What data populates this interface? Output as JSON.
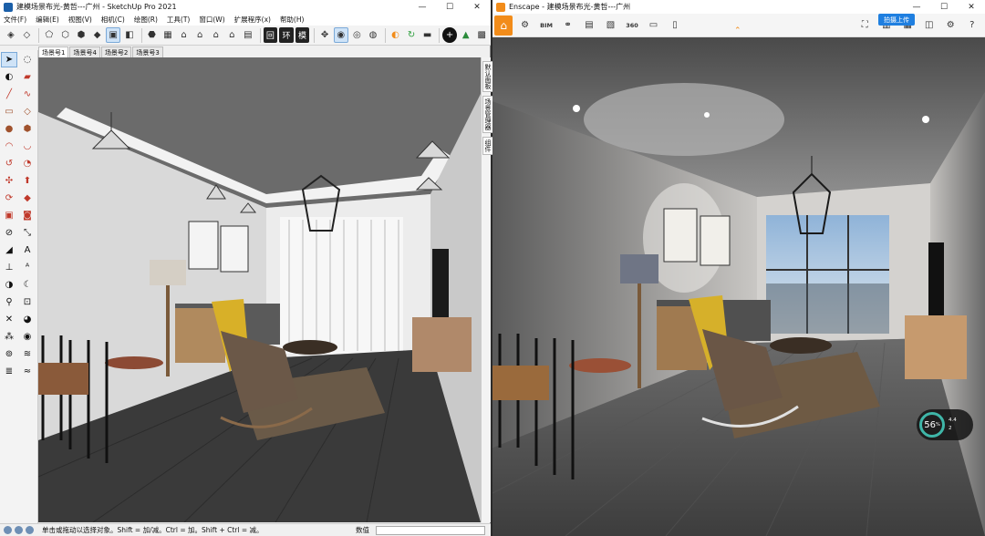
{
  "sketchup": {
    "window_title": "建模场景布光-黄哲---广州 - SketchUp Pro 2021",
    "menu": [
      "文件(F)",
      "编辑(E)",
      "视图(V)",
      "相机(C)",
      "绘图(R)",
      "工具(T)",
      "窗口(W)",
      "扩展程序(x)",
      "帮助(H)"
    ],
    "toolbar_text_icons": [
      "回",
      "环",
      "模"
    ],
    "scene_tabs": [
      "场景号1",
      "场景号4",
      "场景号2",
      "场景号3"
    ],
    "active_tab": "场景号1",
    "right_panel_tabs": [
      "默认面板",
      "场景管理器",
      "组件"
    ],
    "status_message": "单击或拖动以选择对象。Shift = 加/减。Ctrl = 加。Shift + Ctrl = 减。",
    "status_value_label": "数值"
  },
  "enscape": {
    "window_title": "Enscape - 建模场景布光-黄哲---广州",
    "upload_button": "拍摄上传",
    "toolbar_text_icons": [
      "BIM",
      "360"
    ],
    "gauge": {
      "percent": "56",
      "unit": "%",
      "stat_top": "4.4",
      "stat_bottom": "2"
    }
  },
  "colors": {
    "enscape_accent": "#f28c1a",
    "sketchup_blue": "#1b5fa8",
    "upload_blue": "#1f7fe0",
    "gauge_ring": "#3fb6a8"
  }
}
